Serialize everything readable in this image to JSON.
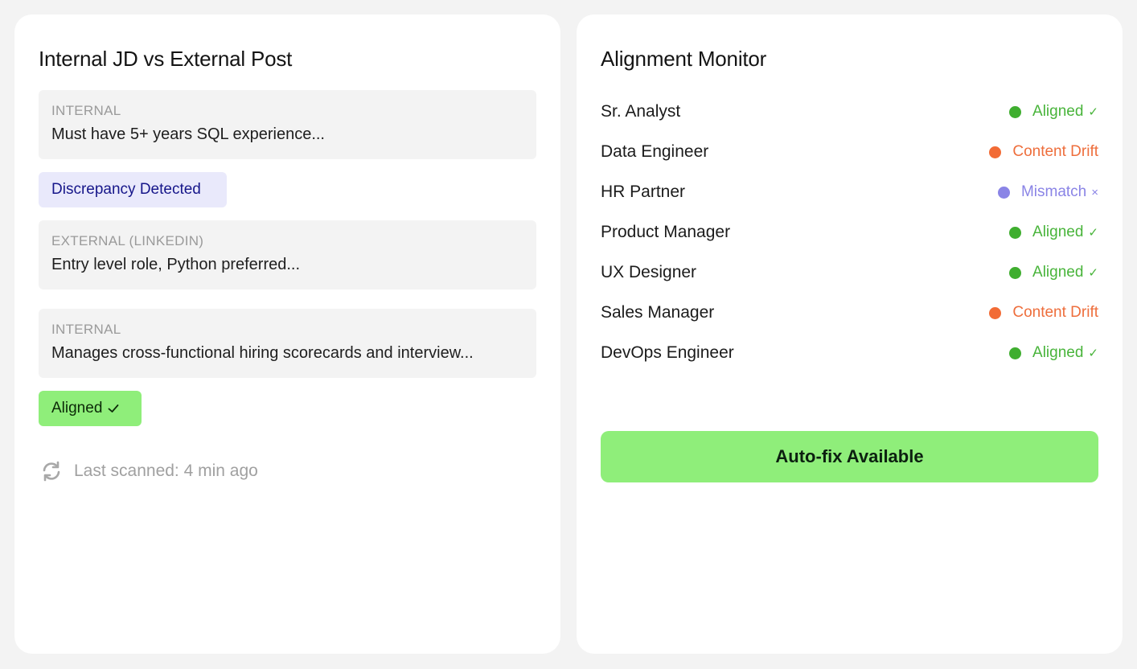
{
  "left_panel": {
    "title": "Internal JD vs External Post",
    "comparisons": [
      {
        "label": "INTERNAL",
        "text": "Must have 5+ years SQL experience..."
      },
      {
        "label": "EXTERNAL (LINKEDIN)",
        "text": "Entry level role, Python preferred..."
      },
      {
        "label": "INTERNAL",
        "text": "Manages cross-functional hiring scorecards and interview..."
      }
    ],
    "discrepancy_badge": "Discrepancy Detected",
    "aligned_badge": "Aligned",
    "last_scanned": "Last scanned: 4 min ago",
    "icons": {
      "refresh": "refresh-icon",
      "check": "check-icon"
    }
  },
  "right_panel": {
    "title": "Alignment Monitor",
    "roles": [
      {
        "name": "Sr. Analyst",
        "status": "Aligned",
        "mark": "✓",
        "kind": "aligned"
      },
      {
        "name": "Data Engineer",
        "status": "Content Drift",
        "mark": "",
        "kind": "drift"
      },
      {
        "name": "HR Partner",
        "status": "Mismatch",
        "mark": "×",
        "kind": "mismatch"
      },
      {
        "name": "Product Manager",
        "status": "Aligned",
        "mark": "✓",
        "kind": "aligned"
      },
      {
        "name": "UX Designer",
        "status": "Aligned",
        "mark": "✓",
        "kind": "aligned"
      },
      {
        "name": "Sales Manager",
        "status": "Content Drift",
        "mark": "",
        "kind": "drift"
      },
      {
        "name": "DevOps Engineer",
        "status": "Aligned",
        "mark": "✓",
        "kind": "aligned"
      }
    ],
    "autofix_label": "Auto-fix Available"
  },
  "colors": {
    "aligned": "#3fae2f",
    "drift": "#f26b35",
    "mismatch": "#8a84e6",
    "accent_green": "#8fee7a",
    "discrepancy_bg": "#e9e9fb"
  }
}
